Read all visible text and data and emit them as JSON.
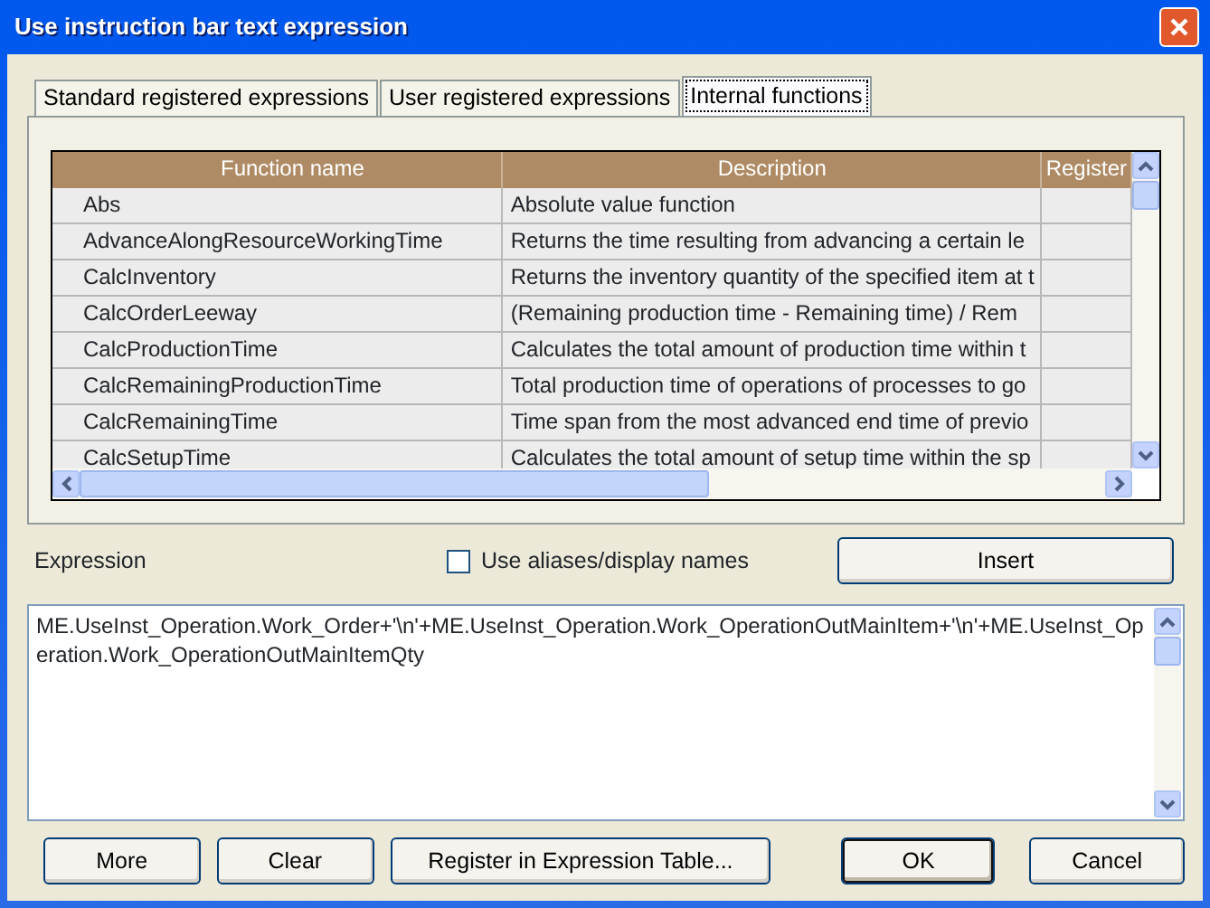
{
  "window": {
    "title": "Use instruction bar text expression"
  },
  "tabs": [
    {
      "label": "Standard registered expressions",
      "selected": false
    },
    {
      "label": "User registered expressions",
      "selected": false
    },
    {
      "label": "Internal functions",
      "selected": true
    }
  ],
  "table": {
    "columns": [
      "Function name",
      "Description",
      "Register"
    ],
    "rows": [
      [
        "Abs",
        "Absolute value function"
      ],
      [
        "AdvanceAlongResourceWorkingTime",
        "Returns the time resulting from advancing a certain le"
      ],
      [
        "CalcInventory",
        "Returns the inventory quantity of the specified item at t"
      ],
      [
        "CalcOrderLeeway",
        "(Remaining production time - Remaining time) / Rem"
      ],
      [
        "CalcProductionTime",
        "Calculates the total amount of production time within t"
      ],
      [
        "CalcRemainingProductionTime",
        "Total production time of operations of processes to go"
      ],
      [
        "CalcRemainingTime",
        "Time span from the most advanced end time of previo"
      ],
      [
        "CalcSetupTime",
        "Calculates the total amount of setup time within the sp"
      ]
    ]
  },
  "expression": {
    "label": "Expression",
    "value": "ME.UseInst_Operation.Work_Order+'\\n'+ME.UseInst_Operation.Work_OperationOutMainItem+'\\n'+ME.UseInst_Operation.Work_OperationOutMainItemQty"
  },
  "alias_checkbox": {
    "label": "Use aliases/display names",
    "checked": false
  },
  "insert_button": "Insert",
  "buttons": [
    {
      "label": "More",
      "default": false
    },
    {
      "label": "Clear",
      "default": false
    },
    {
      "label": "Register in Expression Table...",
      "default": false
    },
    {
      "label": "OK",
      "default": true
    },
    {
      "label": "Cancel",
      "default": false
    }
  ]
}
